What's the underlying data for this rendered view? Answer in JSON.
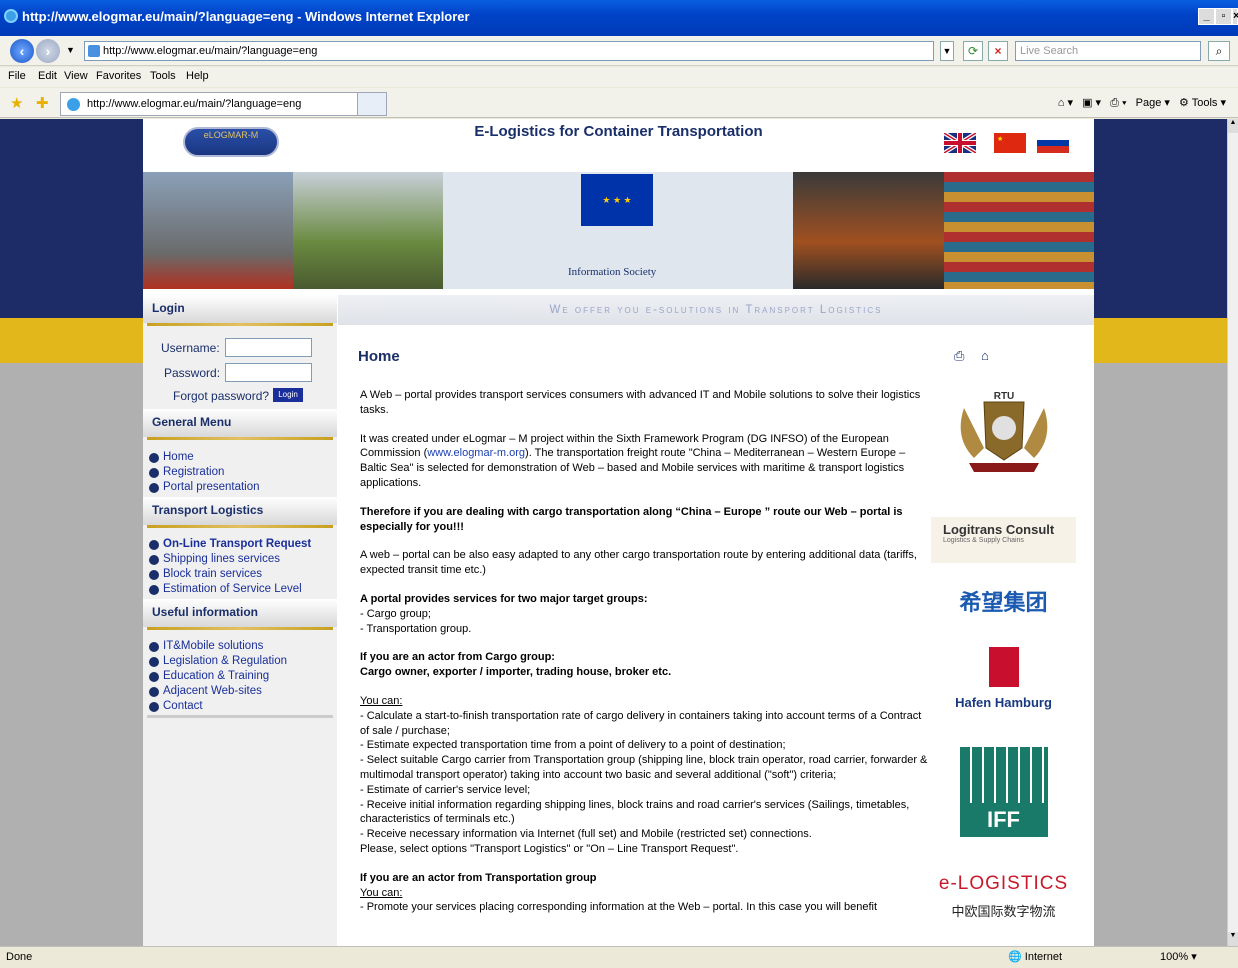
{
  "window": {
    "title": "http://www.elogmar.eu/main/?language=eng - Windows Internet Explorer"
  },
  "address": {
    "url": "http://www.elogmar.eu/main/?language=eng",
    "search_placeholder": "Live Search"
  },
  "menu": {
    "file": "File",
    "edit": "Edit",
    "view": "View",
    "favorites": "Favorites",
    "tools": "Tools",
    "help": "Help"
  },
  "tab": {
    "label": "http://www.elogmar.eu/main/?language=eng"
  },
  "command_bar": {
    "page": "Page",
    "tools": "Tools"
  },
  "site": {
    "logo_text": "eLOGMAR-M",
    "title": "E-Logistics for Container Transportation",
    "slogan": "We offer you e-solutions in Transport Logistics",
    "banner_caption": "Information Society"
  },
  "sidebar": {
    "login_title": "Login",
    "username_label": "Username:",
    "password_label": "Password:",
    "forgot": "Forgot password?",
    "login_btn": "Login",
    "general_title": "General Menu",
    "general_items": [
      "Home",
      "Registration",
      "Portal presentation"
    ],
    "transport_title": "Transport Logistics",
    "transport_items": [
      "On-Line Transport Request",
      "Shipping lines services",
      "Block train services",
      "Estimation of Service Level"
    ],
    "useful_title": "Useful information",
    "useful_items": [
      "IT&Mobile solutions",
      "Legislation & Regulation",
      "Education & Training",
      "Adjacent Web-sites",
      "Contact"
    ]
  },
  "content": {
    "heading": "Home",
    "p1": "A Web – portal provides transport services consumers with advanced IT and Mobile solutions to solve their logistics tasks.",
    "p2_a": "It was created under eLogmar – M project within the Sixth Framework Program (DG INFSO) of the European Commission (",
    "p2_link": "www.elogmar-m.org",
    "p2_b": "). The transportation freight route \"China – Mediterranean – Western Europe – Baltic Sea\" is selected for demonstration of Web – based and Mobile services with maritime & transport logistics applications.",
    "p3": "Therefore if you are dealing with cargo transportation along “China – Europe ” route our Web – portal is especially for you!!!",
    "p4": "A web – portal can be also easy adapted to any other cargo transportation route by entering additional data (tariffs, expected transit time etc.)",
    "p5_title": "A portal provides services for two major target groups:",
    "p5_items": [
      "- Cargo group;",
      "- Transportation group."
    ],
    "p6_title": "If you are an actor from Cargo group:",
    "p6_sub": "Cargo owner, exporter / importer, trading house, broker etc.",
    "you_can": "You can:",
    "p7_items": [
      "- Calculate a start-to-finish transportation rate of cargo delivery in containers taking into account terms of a Contract of sale / purchase;",
      "- Estimate expected transportation time from a point of delivery to a point of destination;",
      "- Select suitable Cargo carrier from Transportation group (shipping line, block train operator, road carrier, forwarder & multimodal transport operator) taking into account two basic and several additional (\"soft\") criteria;",
      "- Estimate of carrier's service level;",
      "- Receive initial information regarding shipping lines, block trains and road carrier's services (Sailings, timetables, characteristics of terminals etc.)",
      "- Receive necessary information via Internet (full set) and Mobile (restricted set) connections.",
      "Please, select options \"Transport Logistics\" or \"On – Line Transport Request\"."
    ],
    "p8_title": "If you are an actor from Transportation group",
    "p8_line": "- Promote your services placing corresponding information at the Web – portal. In this case you will benefit"
  },
  "logos": {
    "rtu": "RTU",
    "logitrans": "Logitrans Consult",
    "logitrans_sub": "Logistics & Supply Chains",
    "xiwang": "希望集团",
    "hamburg": "Hafen Hamburg",
    "iff": "IFF",
    "elog": "e-LOGISTICS",
    "elog_cn": "中欧国际数字物流"
  },
  "status": {
    "left": "Done",
    "zone": "Internet",
    "zoom": "100%"
  },
  "colors": {
    "navy": "#1d2c66",
    "yellow": "#e2b71c",
    "accent": "#1a2f6a"
  }
}
